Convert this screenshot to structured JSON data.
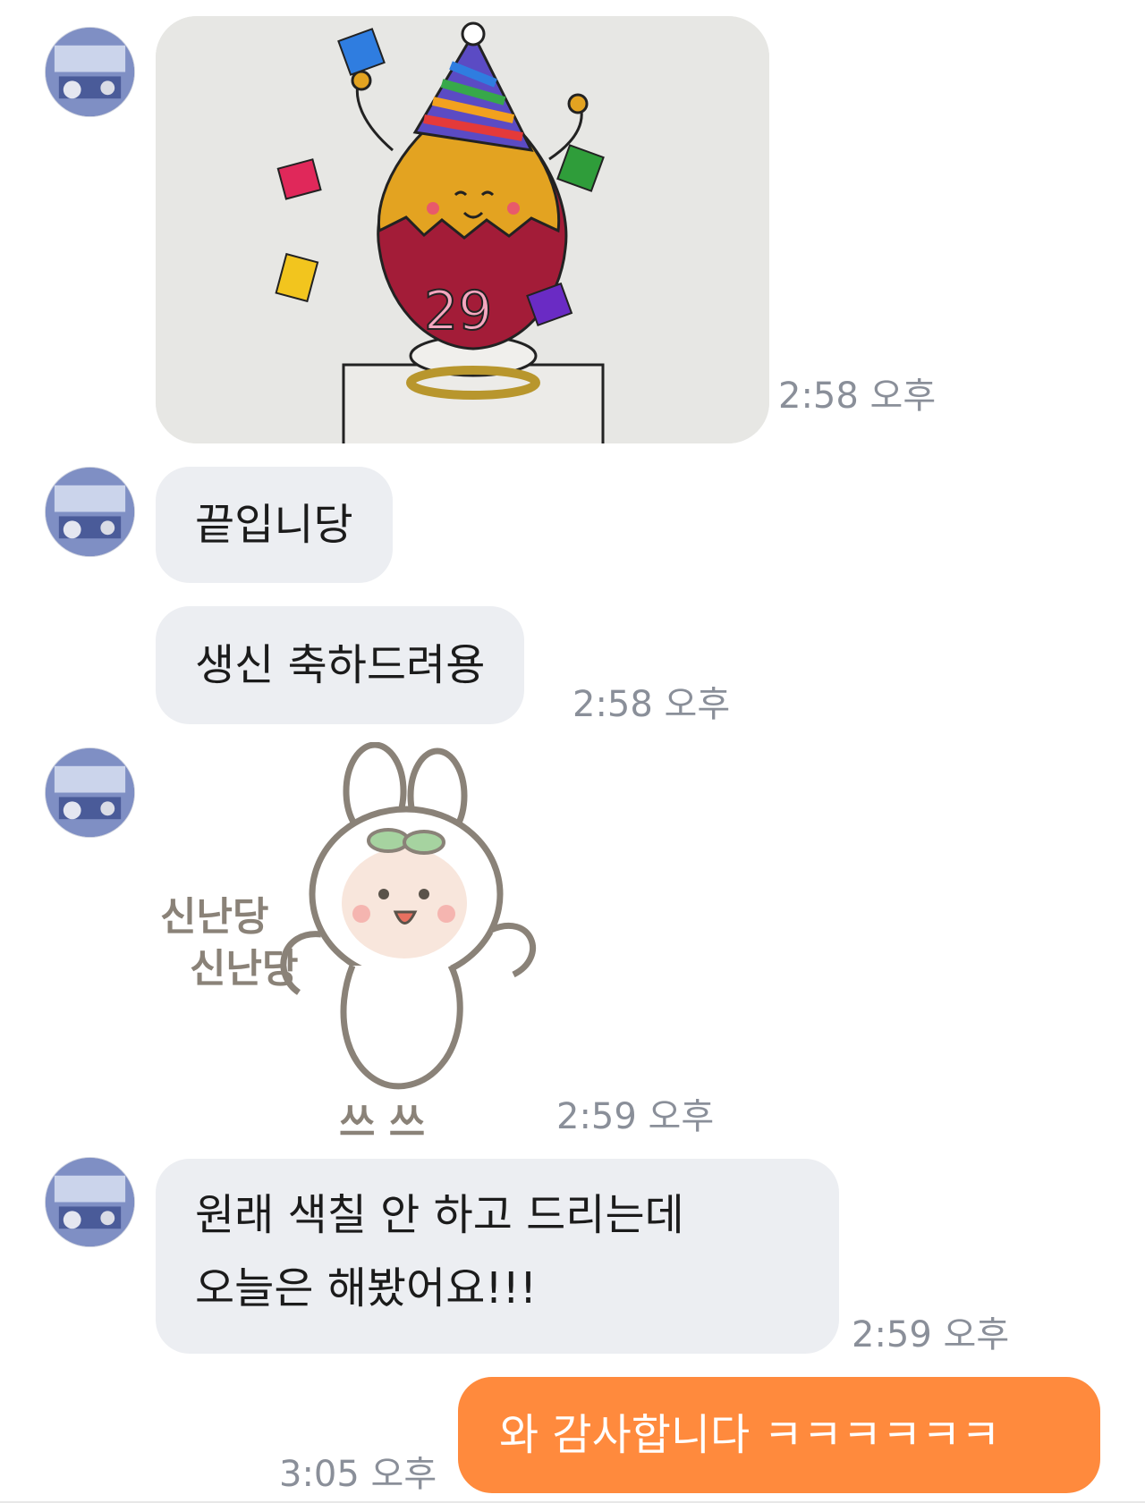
{
  "messages": [
    {
      "type": "image",
      "description_label": "photo",
      "time": "2:58 오후"
    },
    {
      "type": "text",
      "text": "끝입니당"
    },
    {
      "type": "text",
      "text": "생신 축하드려용",
      "time": "2:58 오후"
    },
    {
      "type": "sticker",
      "sticker_text_line1": "신난당",
      "sticker_text_line2": "신난당",
      "sticker_sound": "쓰 쓰",
      "time": "2:59 오후"
    },
    {
      "type": "text",
      "line1": "원래 색칠 안 하고 드리는데",
      "line2": "오늘은 해봤어요!!!",
      "time": "2:59 오후"
    },
    {
      "type": "mine",
      "text": "와 감사합니다 ㅋㅋㅋㅋㅋㅋ",
      "time": "3:05 오후"
    }
  ],
  "photo_cake_number": "29",
  "colors": {
    "incoming_bubble": "#eceef2",
    "outgoing_bubble": "#ff8a3d",
    "timestamp": "#8a8f99"
  }
}
